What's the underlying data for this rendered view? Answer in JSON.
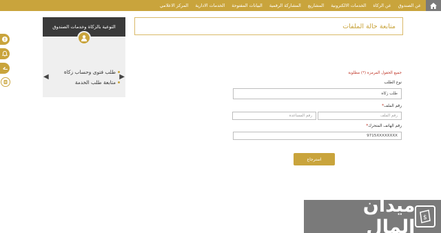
{
  "nav": {
    "items": [
      "عن الصندوق",
      "عن الزكاة",
      "الخدمات الالكترونية",
      "المشاريع",
      "المشاركة الرقمية",
      "البيانات المفتوحة",
      "الخدمات الادارية",
      "المركز الاعلامي"
    ]
  },
  "sidebar": {
    "header": "التوعية بالزكاة وخدمات الصندوق",
    "items": [
      "طلب فتوى وحساب زكاة",
      "متابعة طلب الخدمة"
    ]
  },
  "page": {
    "title": "متابعة حالة الملفات"
  },
  "form": {
    "required_note": "جميع الحقول المرمزة (*) مطلوبة",
    "request_type_label": "نوع الطلب",
    "request_type_value": "طلب زكاة",
    "file_number_label": "رقم الملف",
    "file_number_placeholder": "رقم الملف",
    "assistance_number_placeholder": "رقم المساعدة",
    "phone_label": "رقم الهاتف المتحرك",
    "phone_value": "9715XXXXXXXX",
    "submit_label": "استرجاع",
    "required_star": "*"
  },
  "watermark": {
    "text": "ميدان المال"
  },
  "colors": {
    "accent": "#c9a43c",
    "dark": "#3a3a3a",
    "required": "#c0392b"
  }
}
